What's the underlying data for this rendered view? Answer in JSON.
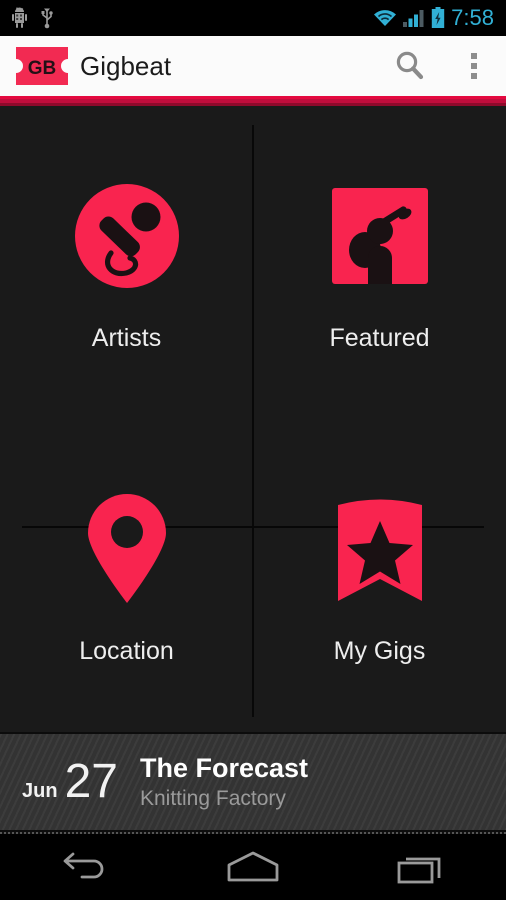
{
  "colors": {
    "accent_pink": "#f9244f",
    "accent_bar": "#c00d3c",
    "background": "#1a1a1a",
    "actionbar_bg": "#fbfbfb",
    "status_blue": "#31b0d5",
    "event_bar_bg": "#333333"
  },
  "statusbar": {
    "time": "7:58",
    "left_icons": [
      {
        "name": "android-debug-icon"
      },
      {
        "name": "usb-icon"
      }
    ],
    "right_icons": [
      {
        "name": "wifi-icon"
      },
      {
        "name": "signal-bars-icon"
      },
      {
        "name": "battery-charging-icon"
      }
    ]
  },
  "actionbar": {
    "app_name": "Gigbeat",
    "logo_text": "GB",
    "logo_name": "gigbeat-ticket-logo",
    "search_label": "Search",
    "overflow_label": "More options"
  },
  "grid": {
    "items": [
      {
        "label": "Artists",
        "icon": "microphone-circle-icon"
      },
      {
        "label": "Featured",
        "icon": "guitarist-square-icon"
      },
      {
        "label": "Location",
        "icon": "map-pin-icon"
      },
      {
        "label": "My Gigs",
        "icon": "bookmark-star-icon"
      }
    ]
  },
  "event": {
    "month": "Jun",
    "day": "27",
    "title": "The Forecast",
    "venue": "Knitting Factory"
  },
  "navbar": {
    "buttons": [
      {
        "label": "Back",
        "icon": "back-arrow-icon"
      },
      {
        "label": "Home",
        "icon": "home-icon"
      },
      {
        "label": "Recents",
        "icon": "recents-icon"
      }
    ]
  }
}
